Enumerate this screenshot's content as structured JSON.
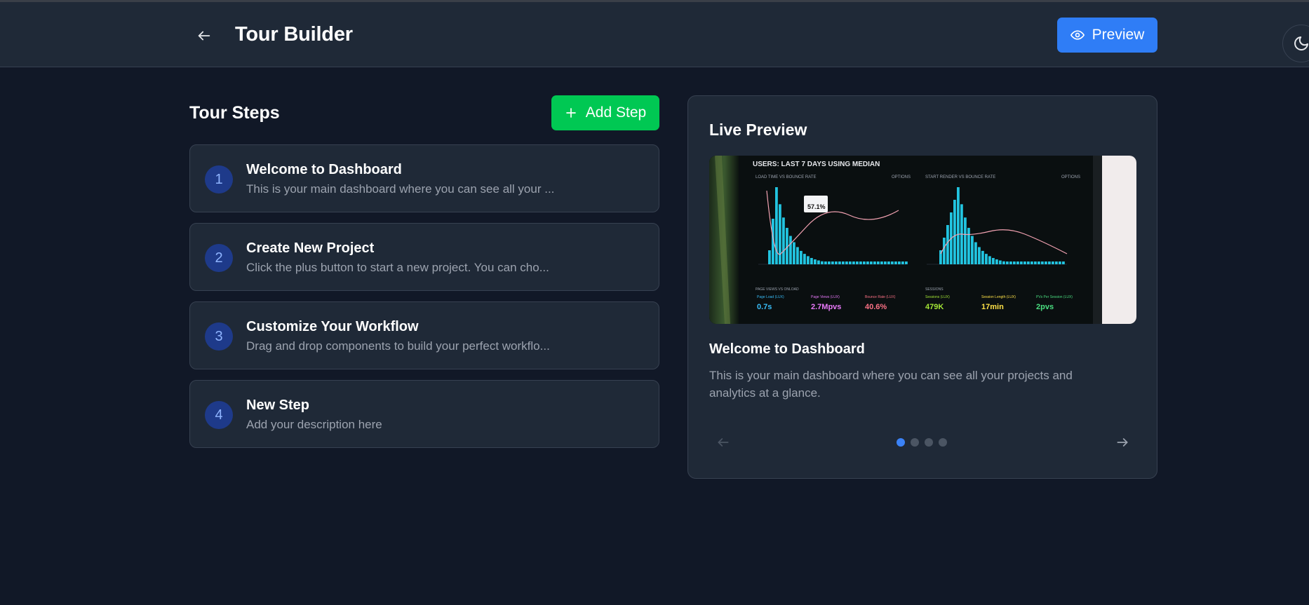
{
  "header": {
    "title": "Tour Builder",
    "preview_label": "Preview"
  },
  "steps_section": {
    "title": "Tour Steps",
    "add_step_label": "Add Step"
  },
  "steps": [
    {
      "number": "1",
      "title": "Welcome to Dashboard",
      "description": "This is your main dashboard where you can see all your ..."
    },
    {
      "number": "2",
      "title": "Create New Project",
      "description": "Click the plus button to start a new project. You can cho..."
    },
    {
      "number": "3",
      "title": "Customize Your Workflow",
      "description": "Drag and drop components to build your perfect workflo..."
    },
    {
      "number": "4",
      "title": "New Step",
      "description": "Add your description here"
    }
  ],
  "preview": {
    "title": "Live Preview",
    "step_title": "Welcome to Dashboard",
    "step_description": "This is your main dashboard where you can see all your projects and analytics at a glance.",
    "total_dots": 4,
    "active_dot": 1,
    "image": {
      "heading": "USERS: LAST 7 DAYS USING MEDIAN",
      "panel_left": "LOAD TIME VS BOUNCE RATE",
      "panel_right": "START RENDER VS BOUNCE RATE",
      "options": "OPTIONS",
      "tooltip": "57.1%",
      "metrics_left_title": "PAGE VIEWS VS ONLOAD",
      "metrics_right_title": "SESSIONS",
      "metrics": [
        {
          "label": "Page Load (LUX)",
          "value": "0.7s",
          "color": "#38bdf8"
        },
        {
          "label": "Page Views (LUX)",
          "value": "2.7Mpvs",
          "color": "#e879f9"
        },
        {
          "label": "Bounce Rate (LUX)",
          "value": "40.6%",
          "color": "#fb7185"
        },
        {
          "label": "Sessions (LUX)",
          "value": "479K",
          "color": "#a3e635"
        },
        {
          "label": "Session Length (LUX)",
          "value": "17min",
          "color": "#fde047"
        },
        {
          "label": "PVs Per Session (LUX)",
          "value": "2pvs",
          "color": "#4ade80"
        }
      ]
    }
  },
  "colors": {
    "background": "#111827",
    "card": "#1f2937",
    "primary": "#2f7df6",
    "success": "#00c853",
    "badge": "#1e3a8a"
  }
}
